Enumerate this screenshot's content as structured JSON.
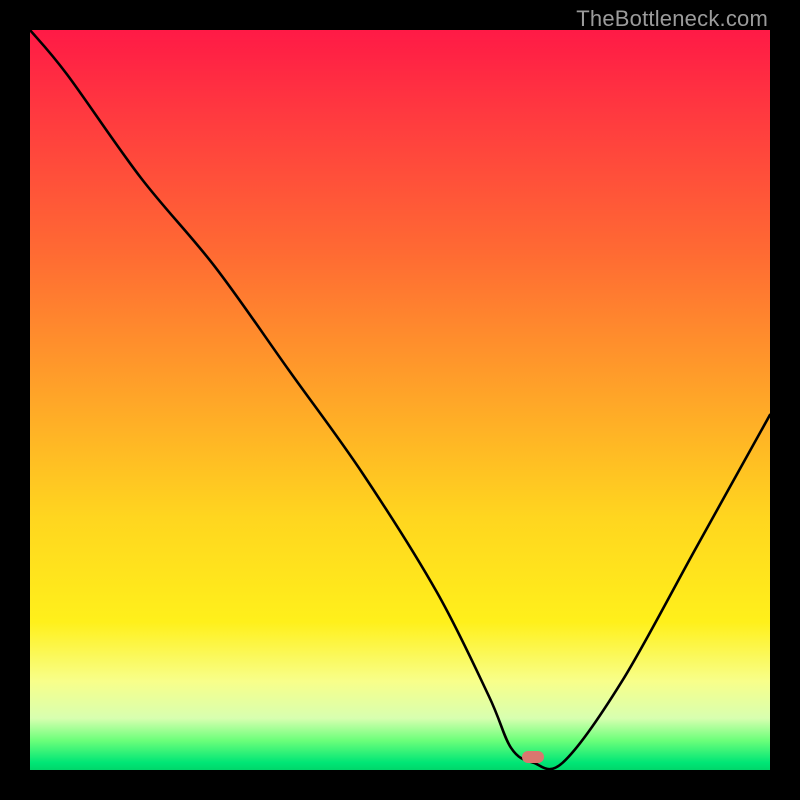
{
  "watermark": "TheBottleneck.com",
  "marker": {
    "x_pct": 68,
    "y_pct": 98.2
  },
  "chart_data": {
    "type": "line",
    "title": "",
    "xlabel": "",
    "ylabel": "",
    "xlim": [
      0,
      100
    ],
    "ylim": [
      0,
      100
    ],
    "series": [
      {
        "name": "curve",
        "x": [
          0,
          5,
          15,
          25,
          35,
          45,
          55,
          62,
          65,
          68,
          72,
          80,
          90,
          100
        ],
        "y": [
          100,
          94,
          80,
          68,
          54,
          40,
          24,
          10,
          3,
          1,
          1,
          12,
          30,
          48
        ]
      }
    ],
    "marker_point": {
      "x": 68,
      "y": 1
    }
  }
}
